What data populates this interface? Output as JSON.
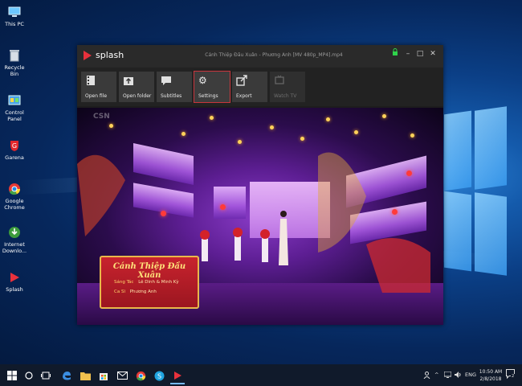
{
  "desktop": {
    "icons": [
      {
        "label": "This PC",
        "icon": "computer-icon"
      },
      {
        "label": "Recycle Bin",
        "icon": "recycle-bin-icon"
      },
      {
        "label": "Control Panel",
        "icon": "control-panel-icon"
      },
      {
        "label": "Garena",
        "icon": "garena-icon"
      },
      {
        "label": "Google Chrome",
        "icon": "chrome-icon"
      },
      {
        "label": "Internet Downlo...",
        "icon": "internet-download-manager-icon"
      },
      {
        "label": "Splash",
        "icon": "splash-icon"
      }
    ]
  },
  "player": {
    "app_name": "splash",
    "window_title": "Cánh Thiệp Đầu Xuân - Phương Anh [MV 480p_MP4].mp4",
    "toolbar": {
      "open_file": "Open file",
      "open_folder": "Open folder",
      "subtitles": "Subtitles",
      "settings": "Settings",
      "export": "Export",
      "watch_tv": "Watch TV"
    },
    "video": {
      "watermark": "CSN",
      "song_title": "Cánh Thiệp Đầu Xuân",
      "composer_label": "Sáng Tác",
      "composer": "Lê Dinh & Minh Kỳ",
      "singer_label": "Ca Sĩ",
      "singer": "Phương Anh"
    }
  },
  "taskbar": {
    "language": "ENG",
    "time": "10:50 AM",
    "date": "2/8/2018",
    "notification_count": "2"
  },
  "colors": {
    "accent": "#e8313c",
    "desktop_blue": "#0b3f86",
    "player_bg": "#1d1d1d"
  }
}
